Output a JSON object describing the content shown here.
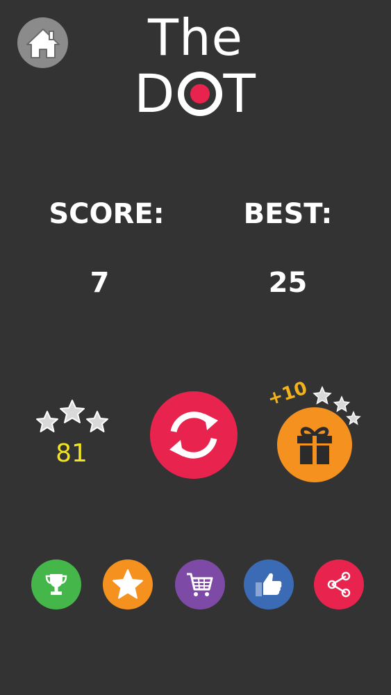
{
  "title": {
    "line1": "The",
    "line2_left": "D",
    "line2_right": "T"
  },
  "score": {
    "label": "SCORE:",
    "value": "7"
  },
  "best": {
    "label": "BEST:",
    "value": "25"
  },
  "stars": {
    "count": "81",
    "count_color": "#f2e41d"
  },
  "gift": {
    "bonus": "+10",
    "color": "#f5911f"
  },
  "icons": {
    "home": "home-icon",
    "replay": "replay-icon",
    "gift": "gift-icon",
    "trophy": "trophy-icon",
    "rate": "star-icon",
    "shop": "cart-icon",
    "like": "thumbs-up-icon",
    "share": "share-icon"
  },
  "colors": {
    "background": "#333333",
    "accent_red": "#e8244e",
    "orange": "#f5911f",
    "green": "#45b649",
    "purple": "#7d4ba6",
    "blue": "#3b6bb5",
    "home_gray": "#8b8b8b"
  }
}
